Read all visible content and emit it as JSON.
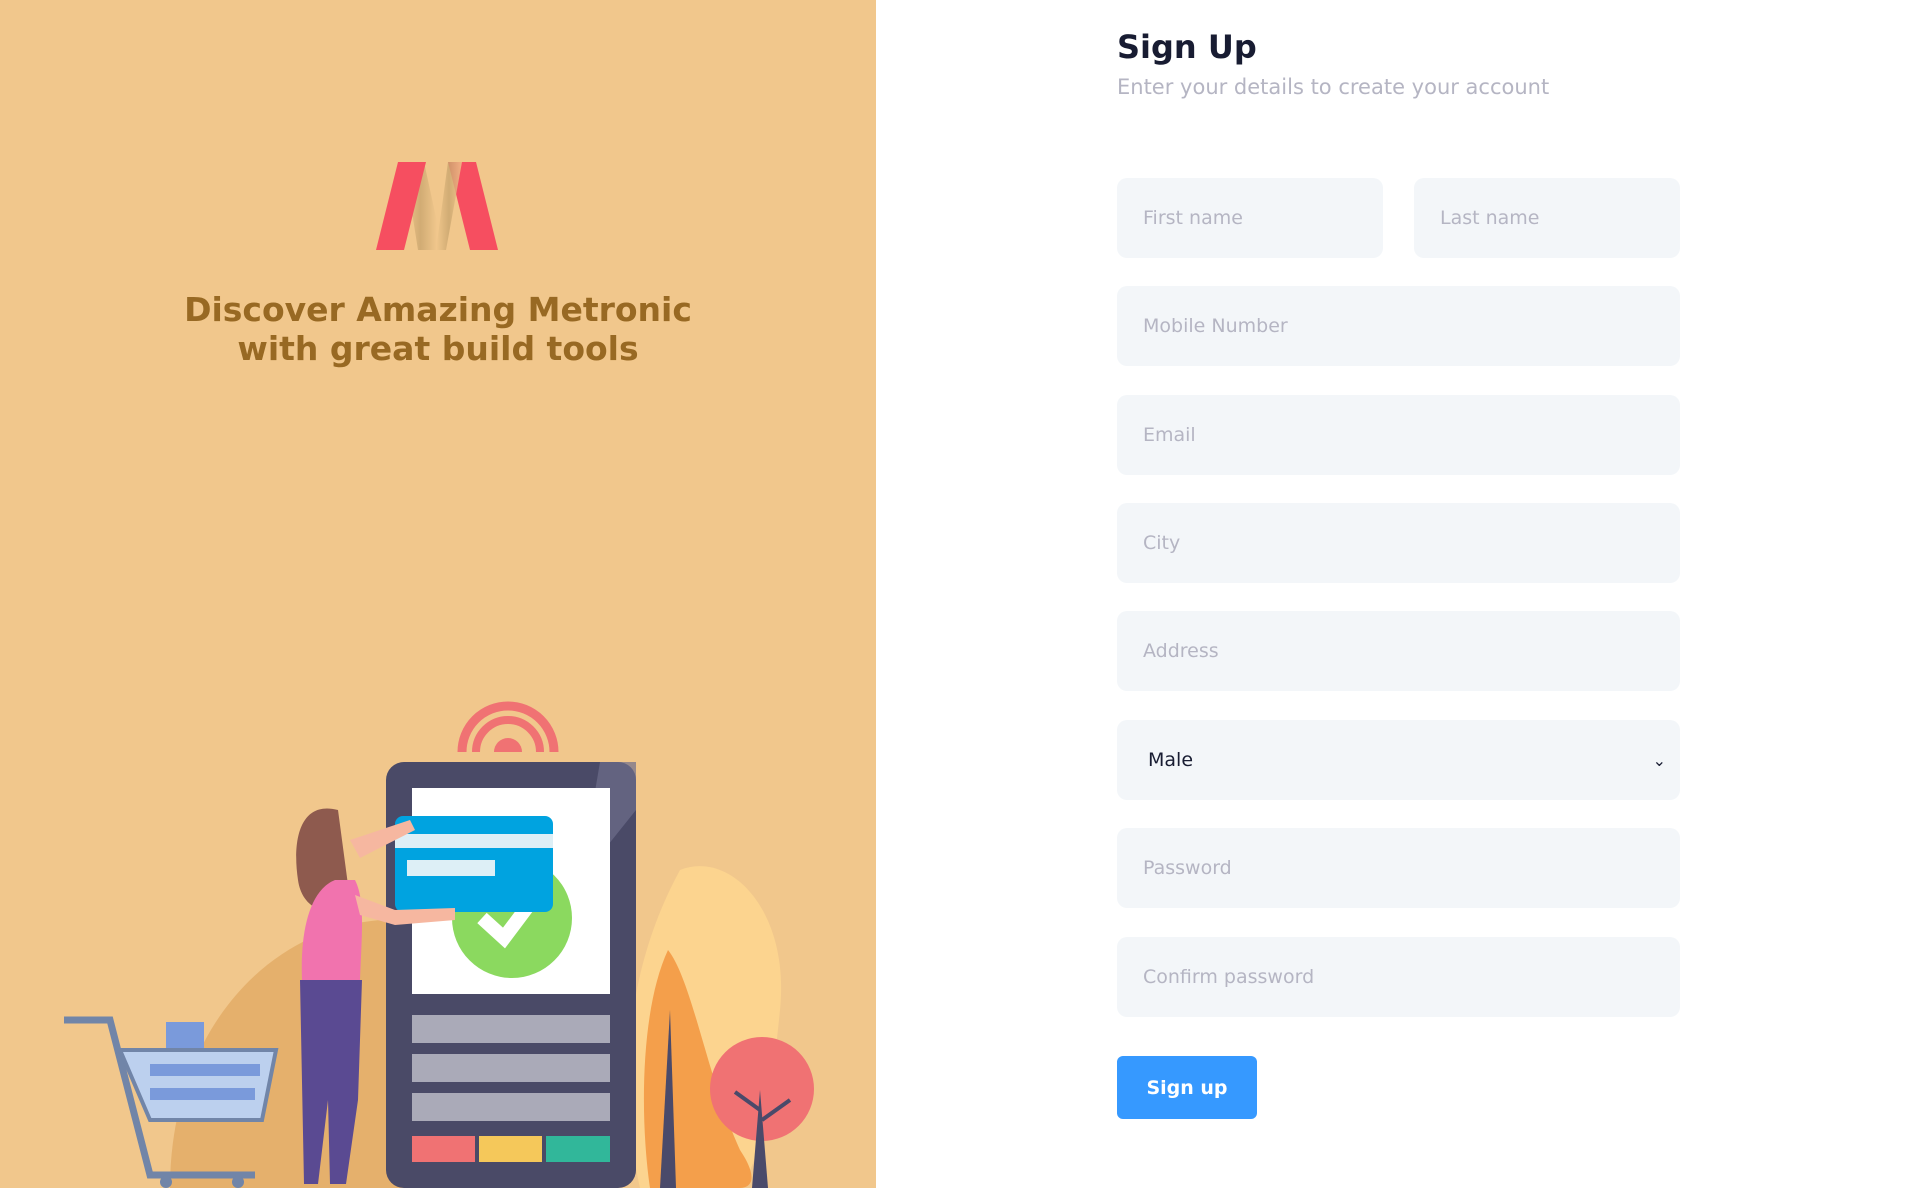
{
  "aside": {
    "title_line1": "Discover Amazing Metronic",
    "title_line2": "with great build tools",
    "logo": "metronic-logo",
    "illustration": "woman-shopping-with-card-illustration"
  },
  "form": {
    "heading": "Sign Up",
    "subheading": "Enter your details to create your account",
    "first_name_placeholder": "First name",
    "last_name_placeholder": "Last name",
    "mobile_placeholder": "Mobile Number",
    "email_placeholder": "Email",
    "city_placeholder": "City",
    "address_placeholder": "Address",
    "gender_selected": "Male",
    "password_placeholder": "Password",
    "confirm_password_placeholder": "Confirm password",
    "submit_label": "Sign up",
    "chevron_icon": "chevron-down-icon"
  },
  "colors": {
    "aside_bg": "#F1C78C",
    "title": "#986923",
    "input_bg": "#F3F6F9",
    "primary": "#3699FF",
    "logo": "#F64E60"
  }
}
